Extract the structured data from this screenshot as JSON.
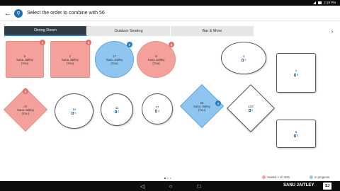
{
  "status_bar": {
    "time": "2:18 PM"
  },
  "header": {
    "back_icon": "arrow-left-icon",
    "app_icon": "restaurant-icon",
    "title": "Select the order to combine with 56"
  },
  "tabs": [
    {
      "label": "Dining Room",
      "active": true
    },
    {
      "label": "Outdoor Seating",
      "active": false
    },
    {
      "label": "Bar & More",
      "active": false
    }
  ],
  "tables": [
    {
      "number": "5",
      "server": "Sanu Jaitley",
      "you": "(You)",
      "badge": "5",
      "status": "seated_long"
    },
    {
      "number": "2",
      "server": "Sanu Jaitley",
      "you": "(You)",
      "badge": "6",
      "status": "seated_long"
    },
    {
      "number": "17",
      "server": "Sanu Jaitley",
      "you": "(You)",
      "badge": "5",
      "status": "in_progress"
    },
    {
      "number": "9",
      "server": "Sanu Jaitley",
      "you": "(You)",
      "badge": "6",
      "status": "seated_long"
    },
    {
      "number": "4",
      "seats": "4",
      "status": "open"
    },
    {
      "number": "7",
      "seats": "6",
      "status": "open"
    },
    {
      "number": "47",
      "server": "Sanu Jaitley",
      "you": "(You)",
      "badge": "5",
      "status": "seated_long"
    },
    {
      "number": "14",
      "seats": "6",
      "status": "open"
    },
    {
      "number": "11",
      "seats": "4",
      "status": "open"
    },
    {
      "number": "77",
      "seats": "4",
      "status": "open"
    },
    {
      "number": "56",
      "server": "Sanu Jaitley",
      "you": "(You)",
      "badge": "4",
      "status": "in_progress"
    },
    {
      "number": "123",
      "seats": "6",
      "status": "open"
    },
    {
      "number": "6",
      "seats": "6",
      "status": "open"
    }
  ],
  "legend": {
    "seated": "Seated > 1h 30m",
    "in_progress": "In progress"
  },
  "colors": {
    "seated": "#f4a19b",
    "in_progress": "#8ec6ef",
    "accent": "#2a7fc7",
    "tab_active": "#2f3b46"
  },
  "user": {
    "name": "SANU JAITLEY",
    "initials": "SJ"
  },
  "pager": {
    "pages": 3,
    "current": 1
  }
}
